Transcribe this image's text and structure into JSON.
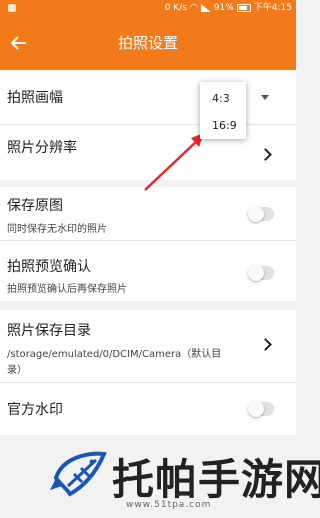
{
  "status_bar": {
    "speed": "0 K/s",
    "battery": "91%",
    "time": "下午4:15"
  },
  "header": {
    "title": "拍照设置",
    "back_icon": "arrow-left-icon"
  },
  "settings": [
    {
      "title": "拍照画幅",
      "control": "dropdown"
    },
    {
      "title": "照片分辨率",
      "control": "chevron"
    },
    {
      "title": "保存原图",
      "subtitle": "同时保存无水印的照片",
      "control": "toggle",
      "value": false
    },
    {
      "title": "拍照预览确认",
      "subtitle": "拍照预览确认后再保存照片",
      "control": "toggle",
      "value": false
    },
    {
      "title": "照片保存目录",
      "subtitle_line1": "/storage/emulated/0/DCIM/Camera（默认目",
      "subtitle_line2": "录）",
      "control": "chevron"
    },
    {
      "title": "官方水印",
      "control": "toggle",
      "value": false
    }
  ],
  "aspect_popup": {
    "options": [
      "4:3",
      "16:9"
    ]
  },
  "watermark": {
    "text": "托帕手游网",
    "url": "www.51tpa.com"
  },
  "colors": {
    "accent": "#f27a1a",
    "arrow": "#e8262c"
  }
}
